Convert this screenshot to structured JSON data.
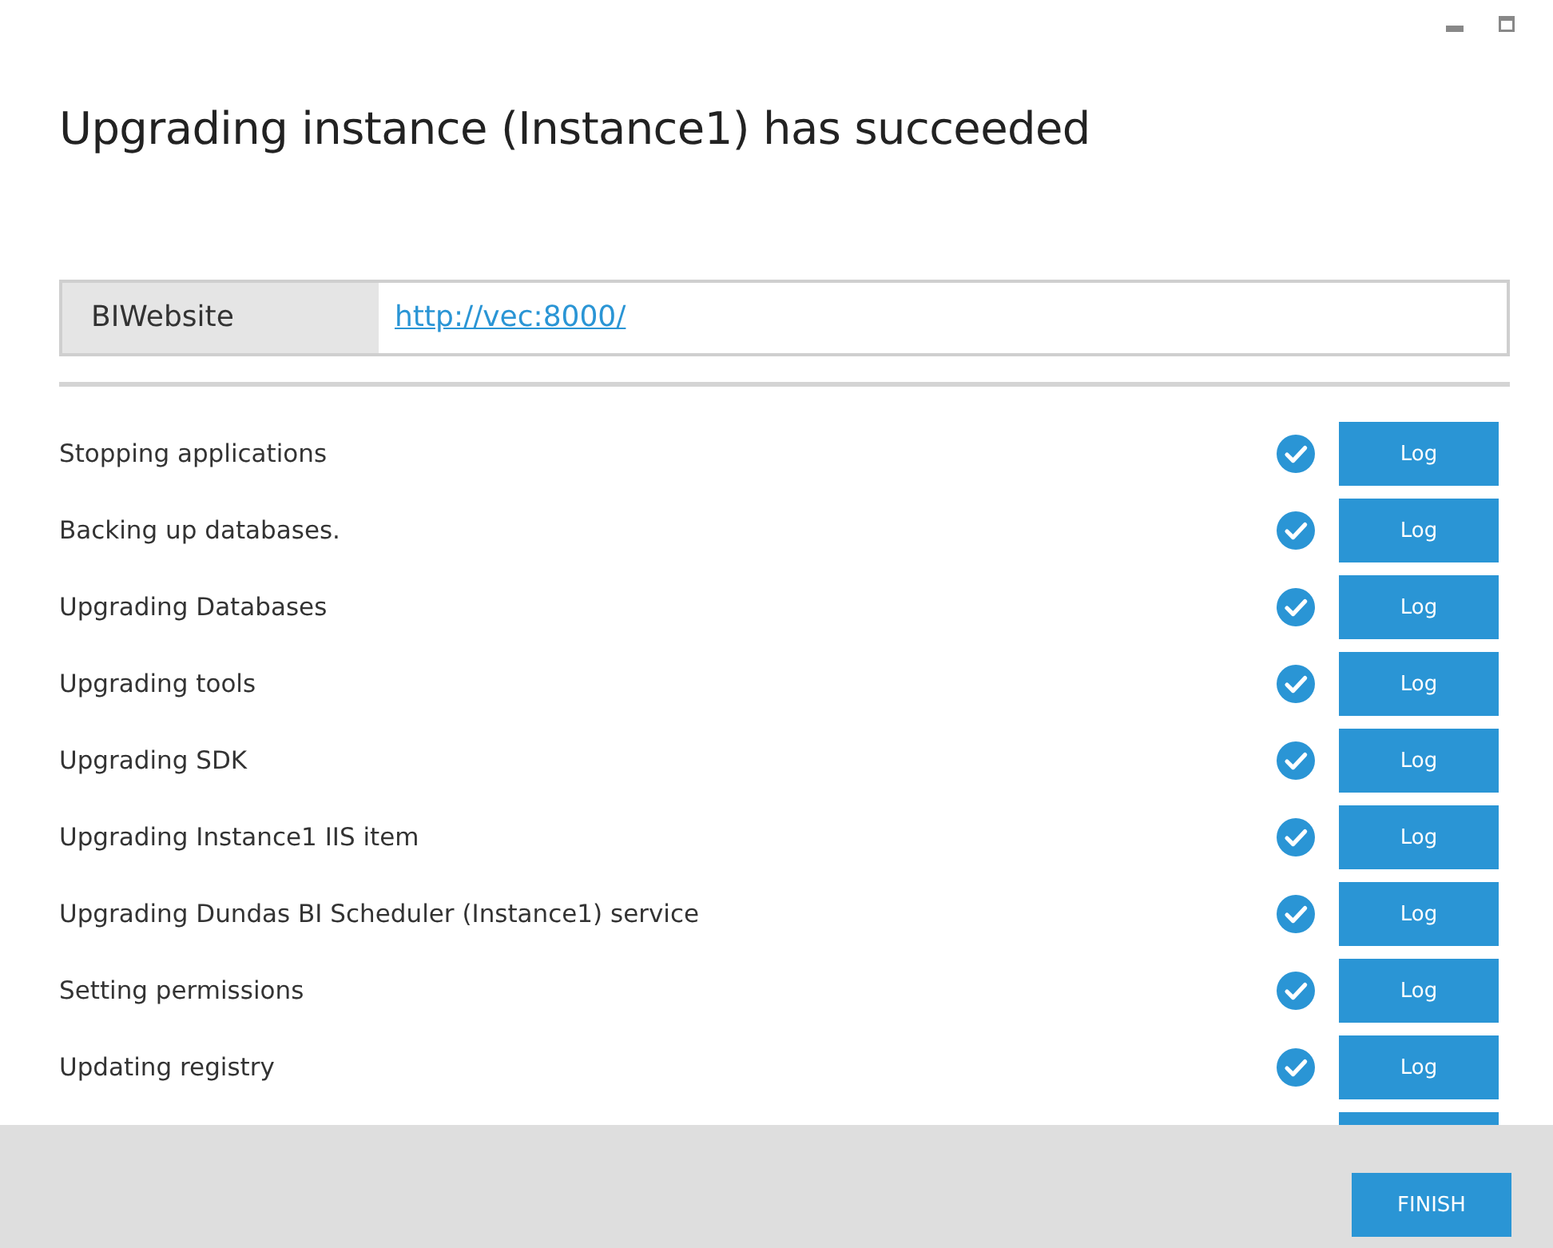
{
  "title": "Upgrading instance (Instance1) has succeeded",
  "site": {
    "label": "BIWebsite",
    "url": "http://vec:8000/"
  },
  "steps": [
    {
      "label": "Stopping applications",
      "done": true,
      "button": "Log"
    },
    {
      "label": "Backing up databases.",
      "done": true,
      "button": "Log"
    },
    {
      "label": "Upgrading Databases",
      "done": true,
      "button": "Log"
    },
    {
      "label": "Upgrading tools",
      "done": true,
      "button": "Log"
    },
    {
      "label": "Upgrading SDK",
      "done": true,
      "button": "Log"
    },
    {
      "label": "Upgrading Instance1 IIS item",
      "done": true,
      "button": "Log"
    },
    {
      "label": "Upgrading Dundas BI Scheduler (Instance1) service",
      "done": true,
      "button": "Log"
    },
    {
      "label": "Setting permissions",
      "done": true,
      "button": "Log"
    },
    {
      "label": "Updating registry",
      "done": true,
      "button": "Log"
    }
  ],
  "finish_button": "FINISH"
}
